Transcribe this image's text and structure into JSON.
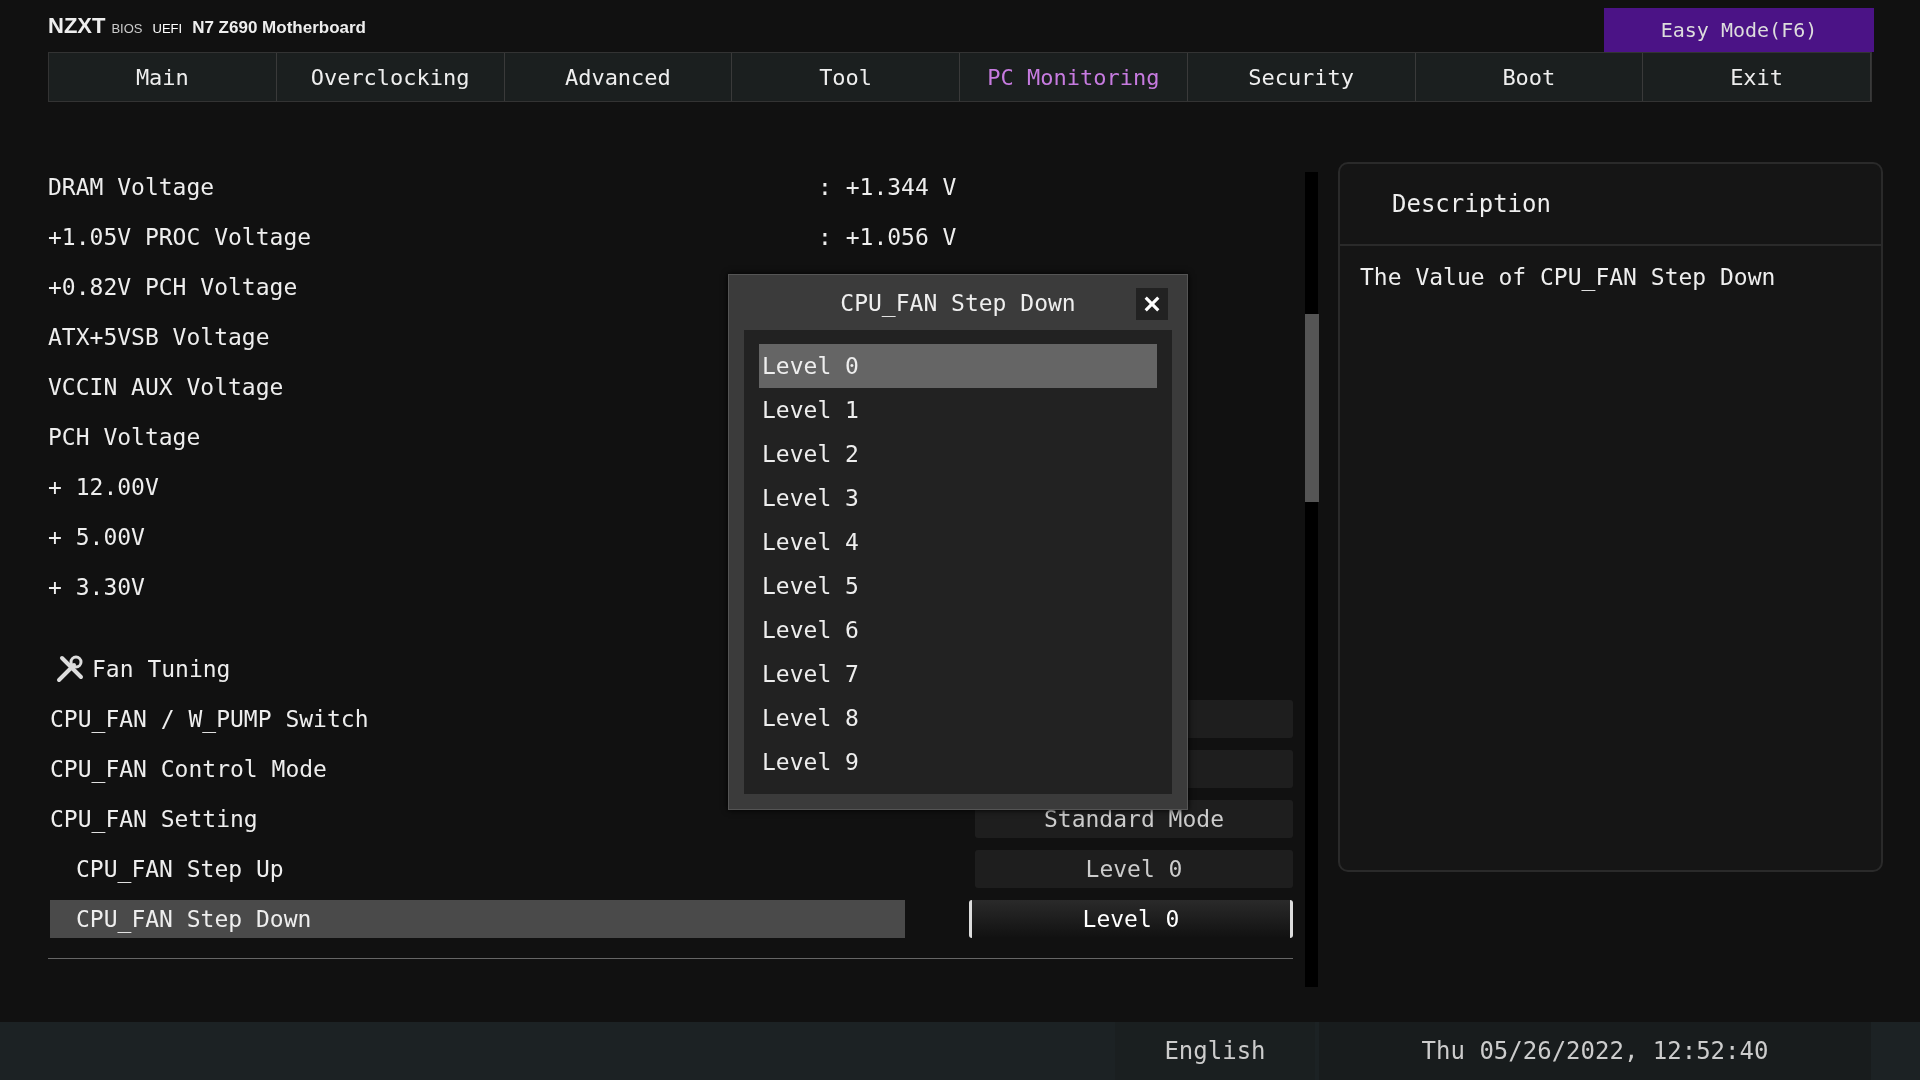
{
  "header": {
    "brand": "NZXT",
    "bios": "BIOS",
    "uefi": "UEFI",
    "model": "N7 Z690 Motherboard",
    "easy_mode": "Easy Mode(F6)"
  },
  "tabs": [
    {
      "label": "Main",
      "selected": false
    },
    {
      "label": "Overclocking",
      "selected": false
    },
    {
      "label": "Advanced",
      "selected": false
    },
    {
      "label": "Tool",
      "selected": false
    },
    {
      "label": "PC Monitoring",
      "selected": true
    },
    {
      "label": "Security",
      "selected": false
    },
    {
      "label": "Boot",
      "selected": false
    },
    {
      "label": "Exit",
      "selected": false
    }
  ],
  "readings": [
    {
      "label": "DRAM Voltage",
      "value": ": +1.344 V"
    },
    {
      "label": "+1.05V PROC Voltage",
      "value": ": +1.056 V"
    },
    {
      "label": "+0.82V PCH Voltage"
    },
    {
      "label": "ATX+5VSB Voltage"
    },
    {
      "label": "VCCIN AUX Voltage"
    },
    {
      "label": "PCH Voltage"
    },
    {
      "label": "+ 12.00V"
    },
    {
      "label": "+ 5.00V"
    },
    {
      "label": "+ 3.30V"
    }
  ],
  "section": "Fan Tuning",
  "settings": [
    {
      "label": "CPU_FAN / W_PUMP Switch",
      "selected": false,
      "sub": false
    },
    {
      "label": "CPU_FAN Control Mode",
      "selected": false,
      "sub": false
    },
    {
      "label": "CPU_FAN Setting",
      "value": "Standard Mode",
      "selected": false,
      "sub": false
    },
    {
      "label": "CPU_FAN Step Up",
      "value": "Level 0",
      "selected": false,
      "sub": true
    },
    {
      "label": "CPU_FAN Step Down",
      "value": "Level 0",
      "selected": true,
      "sub": true
    }
  ],
  "dialog": {
    "title": "CPU_FAN Step Down",
    "options": [
      {
        "label": "Level 0",
        "selected": true
      },
      {
        "label": "Level 1",
        "selected": false
      },
      {
        "label": "Level 2",
        "selected": false
      },
      {
        "label": "Level 3",
        "selected": false
      },
      {
        "label": "Level 4",
        "selected": false
      },
      {
        "label": "Level 5",
        "selected": false
      },
      {
        "label": "Level 6",
        "selected": false
      },
      {
        "label": "Level 7",
        "selected": false
      },
      {
        "label": "Level 8",
        "selected": false
      },
      {
        "label": "Level 9",
        "selected": false
      }
    ]
  },
  "description": {
    "title": "Description",
    "text": "The Value of CPU_FAN Step Down"
  },
  "status_bar": {
    "language": "English",
    "datetime": "Thu 05/26/2022, 12:52:40"
  }
}
